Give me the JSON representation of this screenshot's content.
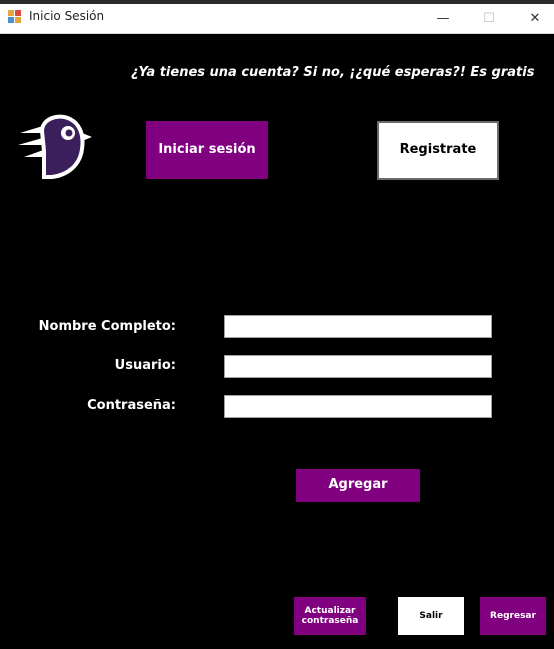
{
  "window": {
    "title": "Inicio Sesión",
    "minimize_glyph": "—",
    "maximize_glyph": "☐",
    "close_glyph": "✕"
  },
  "header": {
    "tagline": "¿Ya tienes una cuenta? Si no, ¡¿qué esperas?! Es gratis"
  },
  "nav": {
    "login_label": "Iniciar sesión",
    "register_label": "Registrate"
  },
  "form": {
    "fullname_label": "Nombre Completo:",
    "fullname_value": "",
    "username_label": "Usuario:",
    "username_value": "",
    "password_label": "Contraseña:",
    "password_value": "",
    "add_label": "Agregar"
  },
  "footer": {
    "update_password_label": "Actualizar contraseña",
    "exit_label": "Salir",
    "back_label": "Regresar"
  },
  "colors": {
    "background": "#000000",
    "accent": "#800080",
    "text": "#ffffff"
  },
  "icons": {
    "logo": "bird-logo-icon",
    "app": "app-window-icon"
  }
}
